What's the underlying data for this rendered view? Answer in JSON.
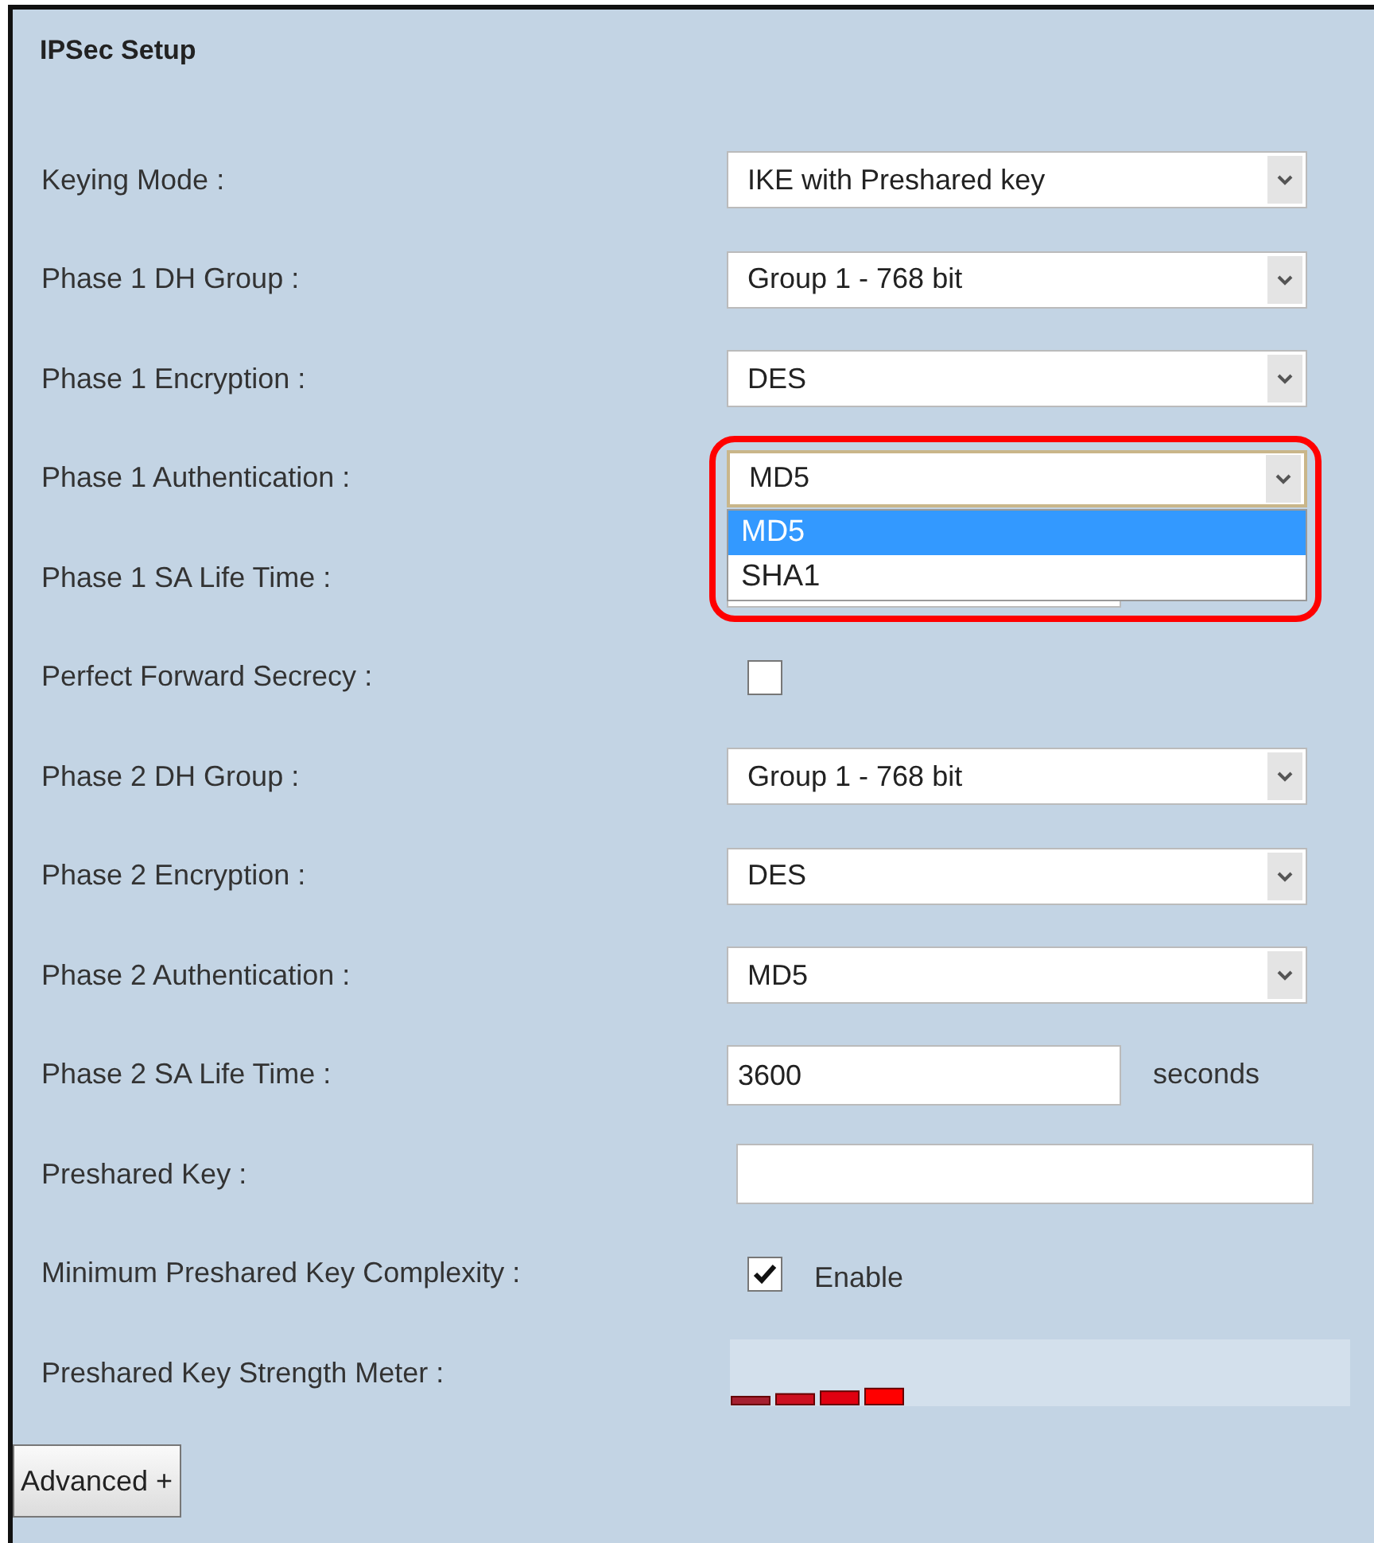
{
  "panel": {
    "title": "IPSec Setup"
  },
  "rows": [
    {
      "kind": "select",
      "label": "Keying Mode :",
      "value": "IKE with Preshared key"
    },
    {
      "kind": "select",
      "label": "Phase 1 DH Group :",
      "value": "Group 1 - 768 bit"
    },
    {
      "kind": "select",
      "label": "Phase 1 Encryption :",
      "value": "DES"
    },
    {
      "kind": "select",
      "label": "Phase 1 Authentication :",
      "value": "MD5",
      "expanded": true,
      "highlighted": true,
      "options": [
        {
          "label": "MD5",
          "selected": true
        },
        {
          "label": "SHA1",
          "selected": false
        }
      ]
    },
    {
      "kind": "text",
      "label": "Phase 1 SA Life Time :"
    },
    {
      "kind": "checkbox",
      "label": "Perfect Forward Secrecy :",
      "checked": false
    },
    {
      "kind": "select",
      "label": "Phase 2 DH Group :",
      "value": "Group 1 - 768 bit"
    },
    {
      "kind": "select",
      "label": "Phase 2 Encryption :",
      "value": "DES"
    },
    {
      "kind": "select",
      "label": "Phase 2 Authentication :",
      "value": "MD5"
    },
    {
      "kind": "text",
      "label": "Phase 2 SA Life Time :",
      "value": "3600",
      "unit": "seconds"
    },
    {
      "kind": "text",
      "label": "Preshared Key :",
      "wide": true
    },
    {
      "kind": "checkbox",
      "label": "Minimum Preshared Key Complexity :",
      "checked": true,
      "caption": "Enable"
    },
    {
      "kind": "meter",
      "label": "Preshared Key Strength Meter :"
    }
  ],
  "buttons": [
    {
      "label": "Advanced +"
    }
  ]
}
